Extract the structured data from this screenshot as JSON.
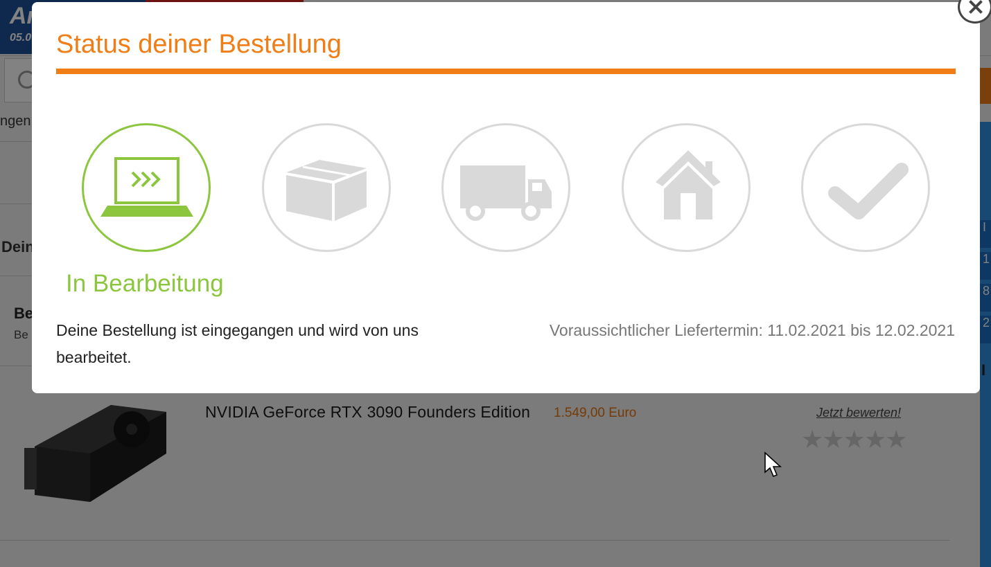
{
  "background": {
    "banner_big": "Ar",
    "banner_small": "05.0",
    "nav_fragment": "ngen",
    "section_fragment": "Dein",
    "order_title_fragment": "Be",
    "order_sub_fragment": "Be",
    "right_cells": [
      "I",
      "1",
      "8",
      "2"
    ],
    "right_heading_fragment": "I",
    "product": {
      "name": "NVIDIA GeForce RTX 3090 Founders Edition",
      "price": "1.549,00 Euro",
      "rate_link": "Jetzt bewerten!",
      "stars": 5
    }
  },
  "modal": {
    "title": "Status deiner Bestellung",
    "steps": [
      {
        "icon": "laptop-icon",
        "active": true
      },
      {
        "icon": "box-icon",
        "active": false
      },
      {
        "icon": "truck-icon",
        "active": false
      },
      {
        "icon": "house-icon",
        "active": false
      },
      {
        "icon": "checkmark-icon",
        "active": false
      }
    ],
    "current_status": "In Bearbeitung",
    "description": "Deine Bestellung ist eingegangen und wird von uns bearbeitet.",
    "delivery": "Voraussichtlicher Liefertermin: 11.02.2021 bis 12.02.2021"
  },
  "colors": {
    "accent": "#f07d16",
    "active_green": "#8cc63f",
    "inactive_gray": "#d9d9d9"
  }
}
